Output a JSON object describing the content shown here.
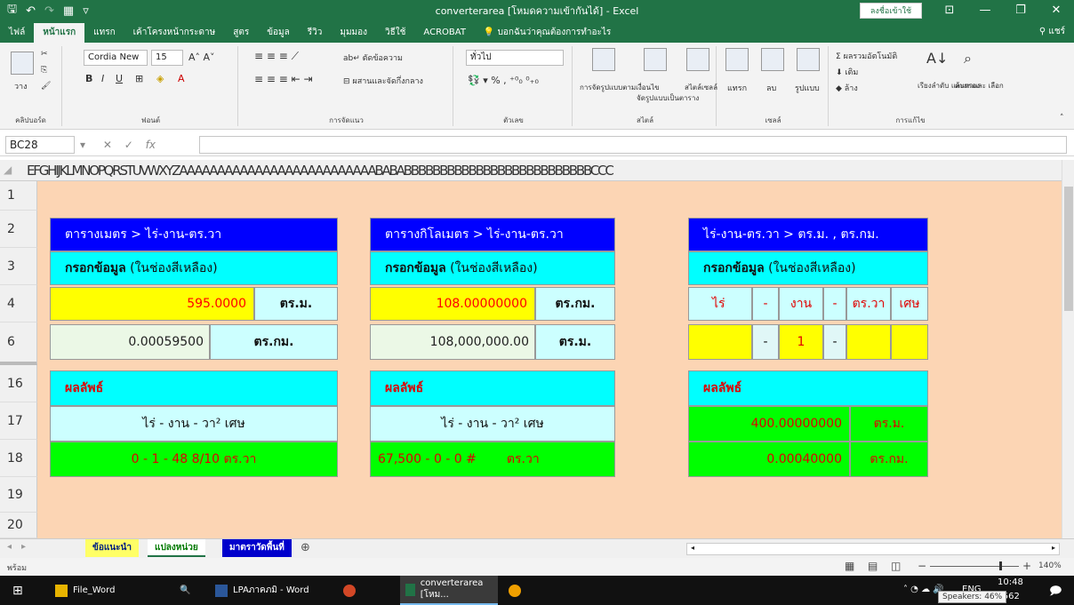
{
  "app": {
    "title": "converterarea  [โหมดความเข้ากันได้]  -  Excel",
    "signin": "ลงชื่อเข้าใช้",
    "share": "แชร์"
  },
  "tabs": [
    "ไฟล์",
    "หน้าแรก",
    "แทรก",
    "เค้าโครงหน้ากระดาษ",
    "สูตร",
    "ข้อมูล",
    "รีวิว",
    "มุมมอง",
    "วิธีใช้",
    "ACROBAT"
  ],
  "tell_me": "บอกฉันว่าคุณต้องการทำอะไร",
  "ribbon": {
    "paste": "วาง",
    "clipboard": "คลิปบอร์ด",
    "font_name": "Cordia New",
    "font_size": "15",
    "font_group": "ฟอนต์",
    "wrap_text": "ตัดข้อความ",
    "merge_center": "ผสานและจัดกึ่งกลาง",
    "alignment": "การจัดแนว",
    "number_format": "ทั่วไป",
    "number_group": "ตัวเลข",
    "cond_format": "การจัดรูปแบบตามเงื่อนไข",
    "format_table": "จัดรูปแบบเป็นตาราง",
    "cell_styles": "สไตล์เซลล์",
    "styles_group": "สไตล์",
    "insert": "แทรก",
    "delete": "ลบ",
    "format": "รูปแบบ",
    "cells_group": "เซลล์",
    "autosum": "ผลรวมอัตโนมัติ",
    "fill": "เติม",
    "clear": "ล้าง",
    "sort_filter": "เรียงลำดับ และกรอง",
    "find_select": "ค้นหาและ เลือก",
    "editing_group": "การแก้ไข"
  },
  "formula_bar": {
    "name_box": "BC28",
    "fx": "fx",
    "content": ""
  },
  "columns_text": "EFGHIJKLMNOPQRSTUVWXYZAAAAAAAAAAAAAAAAAAAAAAAAAABABABBBBBBBBBBBBBBBBBBBBBBBBBBCCC",
  "rows": [
    "1",
    "2",
    "3",
    "4",
    "6",
    "16",
    "17",
    "18",
    "19",
    "20"
  ],
  "table1": {
    "title": "ตารางเมตร > ไร่-งาน-ตร.วา",
    "input_label": "กรอกข้อมูล",
    "input_hint": "(ในช่องสีเหลือง)",
    "value_m2": "595.0000",
    "unit_m2": "ตร.ม.",
    "value_km2": "0.00059500",
    "unit_km2": "ตร.กม.",
    "result_label": "ผลลัพธ์",
    "result_units": "ไร่  -  งาน  -  วา²   เศษ",
    "result_value": "0  -  1  -  48  8/10 ตร.วา"
  },
  "table2": {
    "title": "ตารางกิโลเมตร > ไร่-งาน-ตร.วา",
    "input_label": "กรอกข้อมูล",
    "input_hint": "(ในช่องสีเหลือง)",
    "value_km2": "108.00000000",
    "unit_km2": "ตร.กม.",
    "value_m2": "108,000,000.00",
    "unit_m2": "ตร.ม.",
    "result_label": "ผลลัพธ์",
    "result_units": "ไร่  -  งาน  -  วา²   เศษ",
    "result_value": "67,500  -   0   -    0  #",
    "result_unit": "ตร.วา"
  },
  "table3": {
    "title": "ไร่-งาน-ตร.วา > ตร.ม. , ตร.กม.",
    "input_label": "กรอกข้อมูล",
    "input_hint": "(ในช่องสีเหลือง)",
    "h_rai": "ไร่",
    "h_dash1": "-",
    "h_ngan": "งาน",
    "h_dash2": "-",
    "h_wa": "ตร.วา",
    "h_sed": "เศษ",
    "in_dash1": "-",
    "in_ngan": "1",
    "in_dash2": "-",
    "result_label": "ผลลัพธ์",
    "result_m2": "400.00000000",
    "unit_m2": "ตร.ม.",
    "result_km2": "0.00040000",
    "unit_km2": "ตร.กม."
  },
  "sheets": [
    "ข้อแนะนำ",
    "แปลงหน่วย",
    "มาตราวัดพื้นที่"
  ],
  "status": {
    "ready": "พร้อม",
    "zoom": "140%"
  },
  "taskbar": {
    "file_word": "File_Word",
    "word": "LPAภาคภมิ - Word",
    "excel": "converterarea  [โหม...",
    "lang": "ENG",
    "time": "10:48",
    "date": "/2562",
    "tooltip": "Speakers: 46%"
  }
}
